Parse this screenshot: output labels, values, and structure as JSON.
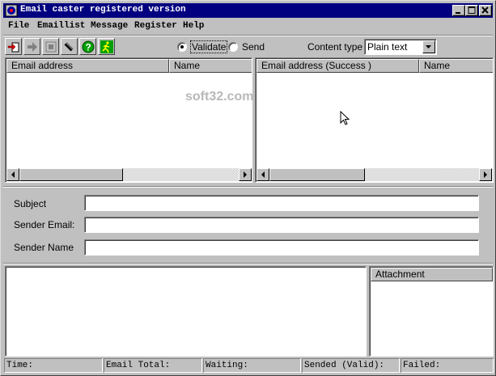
{
  "window": {
    "title": "Email caster registered version"
  },
  "menu": [
    "File",
    "Emaillist",
    "Message",
    "Register",
    "Help"
  ],
  "toolbar": {
    "buttons": [
      "open-list-icon",
      "next-arrow-icon",
      "stop-icon",
      "attach-icon",
      "help-icon",
      "run-icon"
    ],
    "mode": {
      "validate_label": "Validate",
      "send_label": "Send",
      "selected": "Validate"
    },
    "content_type_label": "Content type",
    "content_type_value": "Plain text"
  },
  "left_list": {
    "columns": [
      "Email address",
      "Name"
    ],
    "rows": []
  },
  "right_list": {
    "columns": [
      "Email address (Success )",
      "Name"
    ],
    "rows": []
  },
  "watermark": "soft32.com",
  "form": {
    "subject_label": "Subject",
    "subject_value": "",
    "sender_email_label": "Sender Email:",
    "sender_email_value": "",
    "sender_name_label": "Sender Name",
    "sender_name_value": ""
  },
  "message_body": "",
  "attachment": {
    "header": "Attachment",
    "items": []
  },
  "status": {
    "time": "Time:",
    "email_total": "Email Total:",
    "waiting": "Waiting:",
    "sended": "Sended (Valid):",
    "failed": "Failed:"
  },
  "colors": {
    "titlebar": "#000080",
    "face": "#c0c0c0",
    "field": "#ffffff"
  }
}
